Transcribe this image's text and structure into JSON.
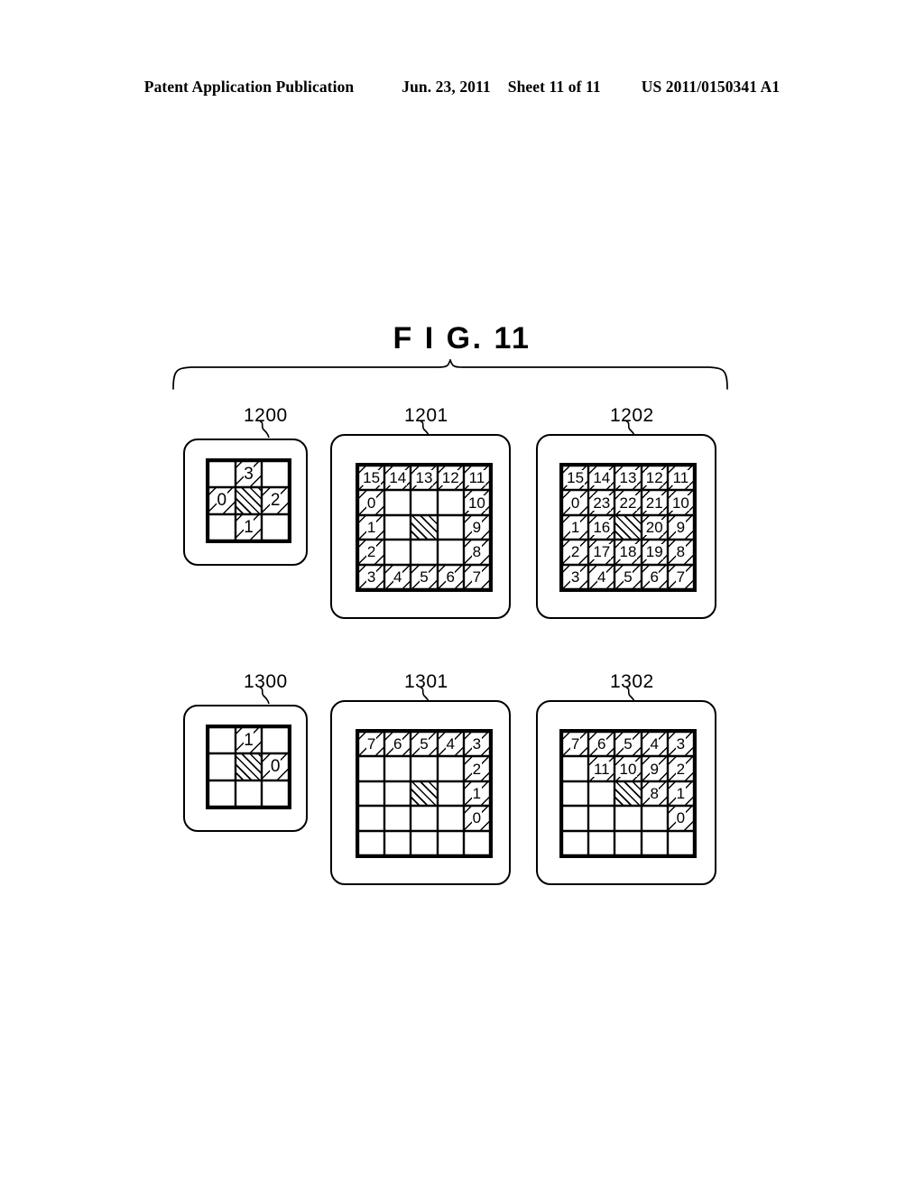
{
  "header": {
    "publication": "Patent Application Publication",
    "date": "Jun. 23, 2011",
    "sheet": "Sheet 11 of 11",
    "patent_number": "US 2011/0150341 A1"
  },
  "figure": {
    "title": "F I G.  11"
  },
  "panels": [
    {
      "id": "1200",
      "label": "1200",
      "rows": 3,
      "cols": 3,
      "center_hatched": true,
      "cells": [
        [
          "",
          "3",
          ""
        ],
        [
          "0",
          "",
          "2"
        ],
        [
          "",
          "1",
          ""
        ]
      ]
    },
    {
      "id": "1201",
      "label": "1201",
      "rows": 5,
      "cols": 5,
      "center_hatched": true,
      "cells": [
        [
          "15",
          "14",
          "13",
          "12",
          "11"
        ],
        [
          "0",
          "",
          "",
          "",
          "10"
        ],
        [
          "1",
          "",
          "",
          "",
          "9"
        ],
        [
          "2",
          "",
          "",
          "",
          "8"
        ],
        [
          "3",
          "4",
          "5",
          "6",
          "7"
        ]
      ]
    },
    {
      "id": "1202",
      "label": "1202",
      "rows": 5,
      "cols": 5,
      "center_hatched": true,
      "cells": [
        [
          "15",
          "14",
          "13",
          "12",
          "11"
        ],
        [
          "0",
          "23",
          "22",
          "21",
          "10"
        ],
        [
          "1",
          "16",
          "",
          "20",
          "9"
        ],
        [
          "2",
          "17",
          "18",
          "19",
          "8"
        ],
        [
          "3",
          "4",
          "5",
          "6",
          "7"
        ]
      ]
    },
    {
      "id": "1300",
      "label": "1300",
      "rows": 3,
      "cols": 3,
      "center_hatched": true,
      "cells": [
        [
          "",
          "1",
          ""
        ],
        [
          "",
          "",
          "0"
        ],
        [
          "",
          "",
          ""
        ]
      ]
    },
    {
      "id": "1301",
      "label": "1301",
      "rows": 5,
      "cols": 5,
      "center_hatched": true,
      "cells": [
        [
          "7",
          "6",
          "5",
          "4",
          "3"
        ],
        [
          "",
          "",
          "",
          "",
          "2"
        ],
        [
          "",
          "",
          "",
          "",
          "1"
        ],
        [
          "",
          "",
          "",
          "",
          "0"
        ],
        [
          "",
          "",
          "",
          "",
          ""
        ]
      ]
    },
    {
      "id": "1302",
      "label": "1302",
      "rows": 5,
      "cols": 5,
      "center_hatched": true,
      "cells": [
        [
          "7",
          "6",
          "5",
          "4",
          "3"
        ],
        [
          "",
          "11",
          "10",
          "9",
          "2"
        ],
        [
          "",
          "",
          "",
          "8",
          "1"
        ],
        [
          "",
          "",
          "",
          "",
          "0"
        ],
        [
          "",
          "",
          "",
          "",
          ""
        ]
      ]
    }
  ],
  "colors": {
    "ink": "#000000",
    "paper": "#ffffff"
  }
}
